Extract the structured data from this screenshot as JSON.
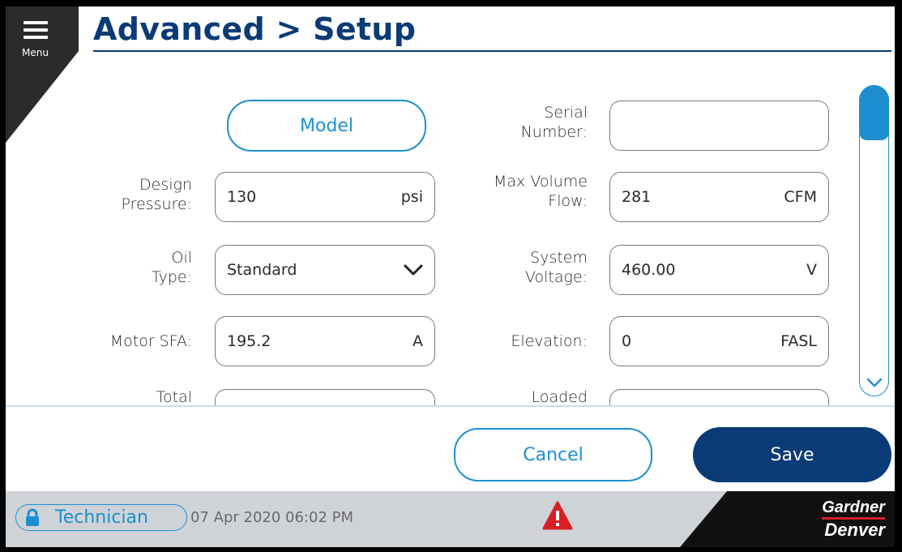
{
  "header": {
    "menu_label": "Menu",
    "title": "Advanced > Setup"
  },
  "form": {
    "model_button": "Model",
    "serial_label": "Serial\nNumber:",
    "serial_value": "",
    "design_pressure_label": "Design\nPressure:",
    "design_pressure_value": "130",
    "design_pressure_unit": "psi",
    "max_volume_label": "Max Volume\nFlow:",
    "max_volume_value": "281",
    "max_volume_unit": "CFM",
    "oil_type_label": "Oil\nType:",
    "oil_type_value": "Standard",
    "voltage_label": "System\nVoltage:",
    "voltage_value": "460.00",
    "voltage_unit": "V",
    "motor_sfa_label": "Motor SFA:",
    "motor_sfa_value": "195.2",
    "motor_sfa_unit": "A",
    "elevation_label": "Elevation:",
    "elevation_value": "0",
    "elevation_unit": "FASL",
    "total_label": "Total",
    "loaded_label": "Loaded"
  },
  "actions": {
    "cancel": "Cancel",
    "save": "Save"
  },
  "footer": {
    "user_level": "Technician",
    "datetime": "07 Apr 2020  06:02 PM",
    "brand_line1": "Gardner",
    "brand_line2": "Denver"
  },
  "colors": {
    "navy": "#0b3b77",
    "accent": "#1d8fd0",
    "alarm": "#d81f26",
    "footer_bg": "#cfd3d7"
  },
  "icons": {
    "menu": "hamburger-icon",
    "chevron": "chevron-down-icon",
    "lock": "lock-icon",
    "alarm": "warning-icon"
  }
}
